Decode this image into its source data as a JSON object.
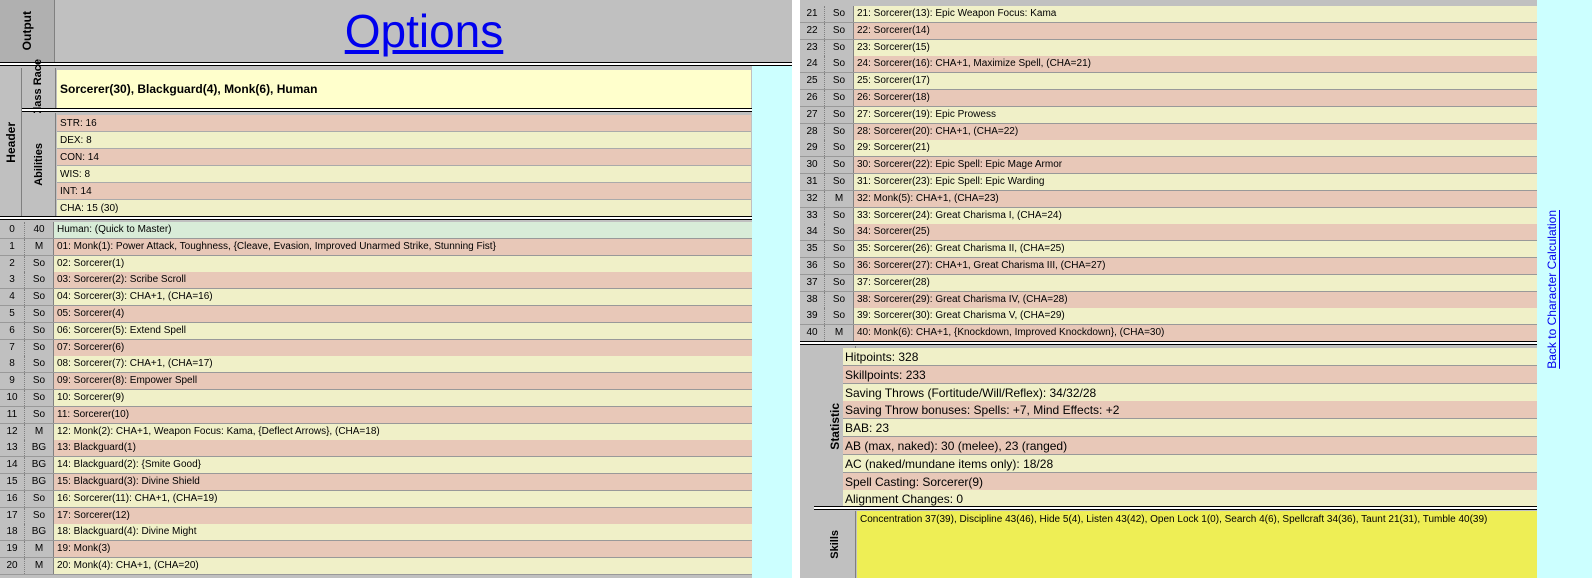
{
  "header": {
    "title": "Options",
    "output_label": "Output",
    "header_label": "Header",
    "classrace_label": "Class Race",
    "abilities_label": "Abilities"
  },
  "classrace": "Sorcerer(30), Blackguard(4), Monk(6), Human",
  "abilities": [
    "STR: 16",
    "DEX: 8",
    "CON: 14",
    "WIS: 8",
    "INT: 14",
    "CHA: 15 (30)"
  ],
  "levels": [
    {
      "n": "0",
      "c": "40",
      "t": "Human: (Quick to Master)"
    },
    {
      "n": "1",
      "c": "M",
      "t": "01: Monk(1): Power Attack, Toughness, {Cleave, Evasion, Improved Unarmed Strike, Stunning Fist}"
    },
    {
      "n": "2",
      "c": "So",
      "t": "02: Sorcerer(1)"
    },
    {
      "n": "3",
      "c": "So",
      "t": "03: Sorcerer(2): Scribe Scroll"
    },
    {
      "n": "4",
      "c": "So",
      "t": "04: Sorcerer(3): CHA+1, (CHA=16)"
    },
    {
      "n": "5",
      "c": "So",
      "t": "05: Sorcerer(4)"
    },
    {
      "n": "6",
      "c": "So",
      "t": "06: Sorcerer(5): Extend Spell"
    },
    {
      "n": "7",
      "c": "So",
      "t": "07: Sorcerer(6)"
    },
    {
      "n": "8",
      "c": "So",
      "t": "08: Sorcerer(7): CHA+1, (CHA=17)"
    },
    {
      "n": "9",
      "c": "So",
      "t": "09: Sorcerer(8): Empower Spell"
    },
    {
      "n": "10",
      "c": "So",
      "t": "10: Sorcerer(9)"
    },
    {
      "n": "11",
      "c": "So",
      "t": "11: Sorcerer(10)"
    },
    {
      "n": "12",
      "c": "M",
      "t": "12: Monk(2): CHA+1, Weapon Focus: Kama, {Deflect Arrows}, (CHA=18)"
    },
    {
      "n": "13",
      "c": "BG",
      "t": "13: Blackguard(1)"
    },
    {
      "n": "14",
      "c": "BG",
      "t": "14: Blackguard(2): {Smite Good}"
    },
    {
      "n": "15",
      "c": "BG",
      "t": "15: Blackguard(3): Divine Shield"
    },
    {
      "n": "16",
      "c": "So",
      "t": "16: Sorcerer(11): CHA+1, (CHA=19)"
    },
    {
      "n": "17",
      "c": "So",
      "t": "17: Sorcerer(12)"
    },
    {
      "n": "18",
      "c": "BG",
      "t": "18: Blackguard(4): Divine Might"
    },
    {
      "n": "19",
      "c": "M",
      "t": "19: Monk(3)"
    },
    {
      "n": "20",
      "c": "M",
      "t": "20: Monk(4): CHA+1, (CHA=20)"
    }
  ],
  "levels_right": [
    {
      "n": "21",
      "c": "So",
      "t": "21: Sorcerer(13): Epic Weapon Focus: Kama"
    },
    {
      "n": "22",
      "c": "So",
      "t": "22: Sorcerer(14)"
    },
    {
      "n": "23",
      "c": "So",
      "t": "23: Sorcerer(15)"
    },
    {
      "n": "24",
      "c": "So",
      "t": "24: Sorcerer(16): CHA+1, Maximize Spell, (CHA=21)"
    },
    {
      "n": "25",
      "c": "So",
      "t": "25: Sorcerer(17)"
    },
    {
      "n": "26",
      "c": "So",
      "t": "26: Sorcerer(18)"
    },
    {
      "n": "27",
      "c": "So",
      "t": "27: Sorcerer(19): Epic Prowess"
    },
    {
      "n": "28",
      "c": "So",
      "t": "28: Sorcerer(20): CHA+1, (CHA=22)"
    },
    {
      "n": "29",
      "c": "So",
      "t": "29: Sorcerer(21)"
    },
    {
      "n": "30",
      "c": "So",
      "t": "30: Sorcerer(22): Epic Spell: Epic Mage Armor"
    },
    {
      "n": "31",
      "c": "So",
      "t": "31: Sorcerer(23): Epic Spell: Epic Warding"
    },
    {
      "n": "32",
      "c": "M",
      "t": "32: Monk(5): CHA+1, (CHA=23)"
    },
    {
      "n": "33",
      "c": "So",
      "t": "33: Sorcerer(24): Great Charisma I, (CHA=24)"
    },
    {
      "n": "34",
      "c": "So",
      "t": "34: Sorcerer(25)"
    },
    {
      "n": "35",
      "c": "So",
      "t": "35: Sorcerer(26): Great Charisma II, (CHA=25)"
    },
    {
      "n": "36",
      "c": "So",
      "t": "36: Sorcerer(27): CHA+1, Great Charisma III, (CHA=27)"
    },
    {
      "n": "37",
      "c": "So",
      "t": "37: Sorcerer(28)"
    },
    {
      "n": "38",
      "c": "So",
      "t": "38: Sorcerer(29): Great Charisma IV, (CHA=28)"
    },
    {
      "n": "39",
      "c": "So",
      "t": "39: Sorcerer(30): Great Charisma V, (CHA=29)"
    },
    {
      "n": "40",
      "c": "M",
      "t": "40: Monk(6): CHA+1, {Knockdown, Improved Knockdown}, (CHA=30)"
    }
  ],
  "statistic_label": "Statistic",
  "statistics": [
    "Hitpoints: 328",
    "Skillpoints: 233",
    "Saving Throws (Fortitude/Will/Reflex): 34/32/28",
    "Saving Throw bonuses: Spells: +7, Mind Effects: +2",
    "BAB: 23",
    "AB (max, naked): 30 (melee), 23 (ranged)",
    "AC (naked/mundane items only): 18/28",
    "Spell Casting: Sorcerer(9)",
    "Alignment Changes: 0"
  ],
  "skills_label": "Skills",
  "skills": "Concentration 37(39), Discipline 43(46), Hide 5(4), Listen 43(42), Open Lock 1(0), Search 4(6), Spellcraft 34(36), Taunt 21(31), Tumble 40(39)",
  "back_link": "Back to Character Calculation",
  "colors": {
    "link": "#0000ee",
    "pink": "#e8c8b8",
    "yellow": "#f0f0c8",
    "green": "#d8ecd8",
    "skills": "#eeee55"
  }
}
